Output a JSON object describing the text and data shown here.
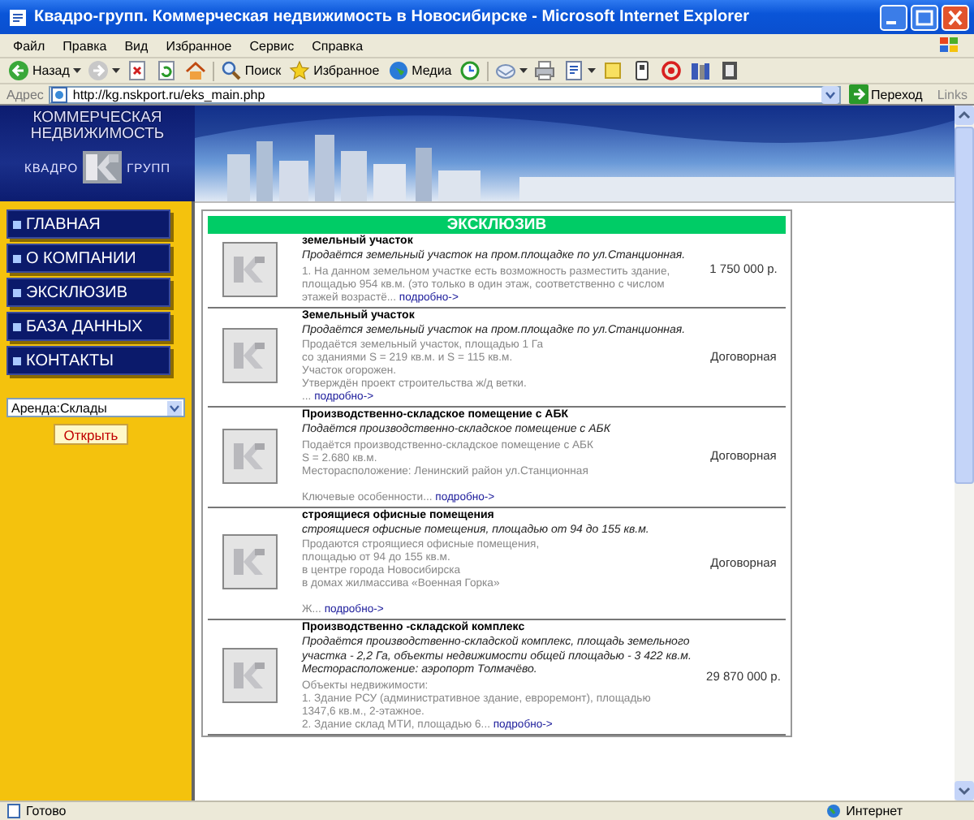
{
  "window": {
    "title": "Квадро-групп. Коммерческая недвижимость в Новосибирске - Microsoft Internet Explorer"
  },
  "menu": [
    "Файл",
    "Правка",
    "Вид",
    "Избранное",
    "Сервис",
    "Справка"
  ],
  "toolbar": [
    {
      "kind": "back",
      "label": "Назад",
      "menu": true
    },
    {
      "kind": "forward",
      "menu": true
    },
    {
      "kind": "stop"
    },
    {
      "kind": "refresh"
    },
    {
      "kind": "home"
    },
    {
      "kind": "search",
      "label": "Поиск"
    },
    {
      "kind": "favorites",
      "label": "Избранное"
    },
    {
      "kind": "media",
      "label": "Медиа"
    },
    {
      "kind": "history"
    },
    {
      "kind": "mail",
      "menu": true
    },
    {
      "kind": "print"
    },
    {
      "kind": "edit",
      "menu": true
    },
    {
      "kind": "note"
    },
    {
      "kind": "messenger"
    },
    {
      "kind": "at"
    },
    {
      "kind": "research"
    },
    {
      "kind": "book"
    }
  ],
  "address": {
    "label": "Адрес",
    "value": "http://kg.nskport.ru/eks_main.php",
    "go": "Переход",
    "links": "Links"
  },
  "site": {
    "logo": {
      "line1": "КОММЕРЧЕСКАЯ",
      "line2": "НЕДВИЖИМОСТЬ",
      "left": "КВАДРО",
      "right": "ГРУПП"
    },
    "nav": [
      "ГЛАВНАЯ",
      "О КОМПАНИИ",
      "ЭКСКЛЮЗИВ",
      "БАЗА ДАННЫХ",
      "КОНТАКТЫ"
    ],
    "filter": {
      "value": "Аренда:Склады",
      "button": "Открыть"
    },
    "section_title": "ЭКСКЛЮЗИВ",
    "listings": [
      {
        "title": "земельный участок",
        "subtitle": "Продаётся земельный участок на пром.площадке по ул.Станционная.",
        "lines": [
          "1. На данном земельном участке есть возможность разместить здание,",
          "площадью 954 кв.м. (это только в один этаж, соответственно с числом"
        ],
        "gap": false,
        "tail": "этажей возрастё...",
        "more": "подробно->",
        "price": "1 750 000 р."
      },
      {
        "title": "Земельный участок",
        "subtitle": "Продаётся земельный участок на пром.площадке по ул.Станционная.",
        "lines": [
          "Продаётся земельный участок, площадью 1 Га",
          "со зданиями S = 219 кв.м. и S = 115 кв.м.",
          "Участок огорожен.",
          "Утверждён проект строительства ж/д ветки."
        ],
        "gap": false,
        "tail": "...",
        "more": "подробно->",
        "price": "Договорная"
      },
      {
        "title": "Производственно-складское помещение с АБК",
        "subtitle": "Подаётся производственно-складское помещение с АБК",
        "lines": [
          "Подаётся производственно-складское помещение с АБК",
          "S = 2.680 кв.м.",
          "Месторасположение: Ленинский район ул.Станционная"
        ],
        "gap": true,
        "tail": "Ключевые особенности...",
        "more": "подробно->",
        "price": "Договорная"
      },
      {
        "title": "строящиеся офисные помещения",
        "subtitle": "строящиеся офисные помещения, площадью от 94 до 155 кв.м.",
        "lines": [
          "Продаются строящиеся офисные помещения,",
          "площадью от 94 до 155 кв.м.",
          "в центре города Новосибирска",
          "в домах жилмассива «Военная Горка»"
        ],
        "gap": true,
        "tail": "Ж...",
        "more": "подробно->",
        "price": "Договорная"
      },
      {
        "title": "Производственно -складской комплекс",
        "subtitle": "Продаётся производственно-складской комплекс, площадь земельного участка - 2,2 Га, объекты недвижимости общей площадью - 3 422 кв.м. Месторасположение: аэропорт Толмачёво.",
        "lines": [
          "Объекты недвижимости:",
          "1. Здание РСУ (административное здание, евроремонт), площадью",
          "1347,6 кв.м., 2-этажное."
        ],
        "gap": false,
        "tail": "2. Здание склад МТИ, площадью 6...",
        "more": "подробно->",
        "price": "29 870 000 р."
      }
    ]
  },
  "status_bar": {
    "text": "Готово",
    "zone": "Интернет"
  }
}
